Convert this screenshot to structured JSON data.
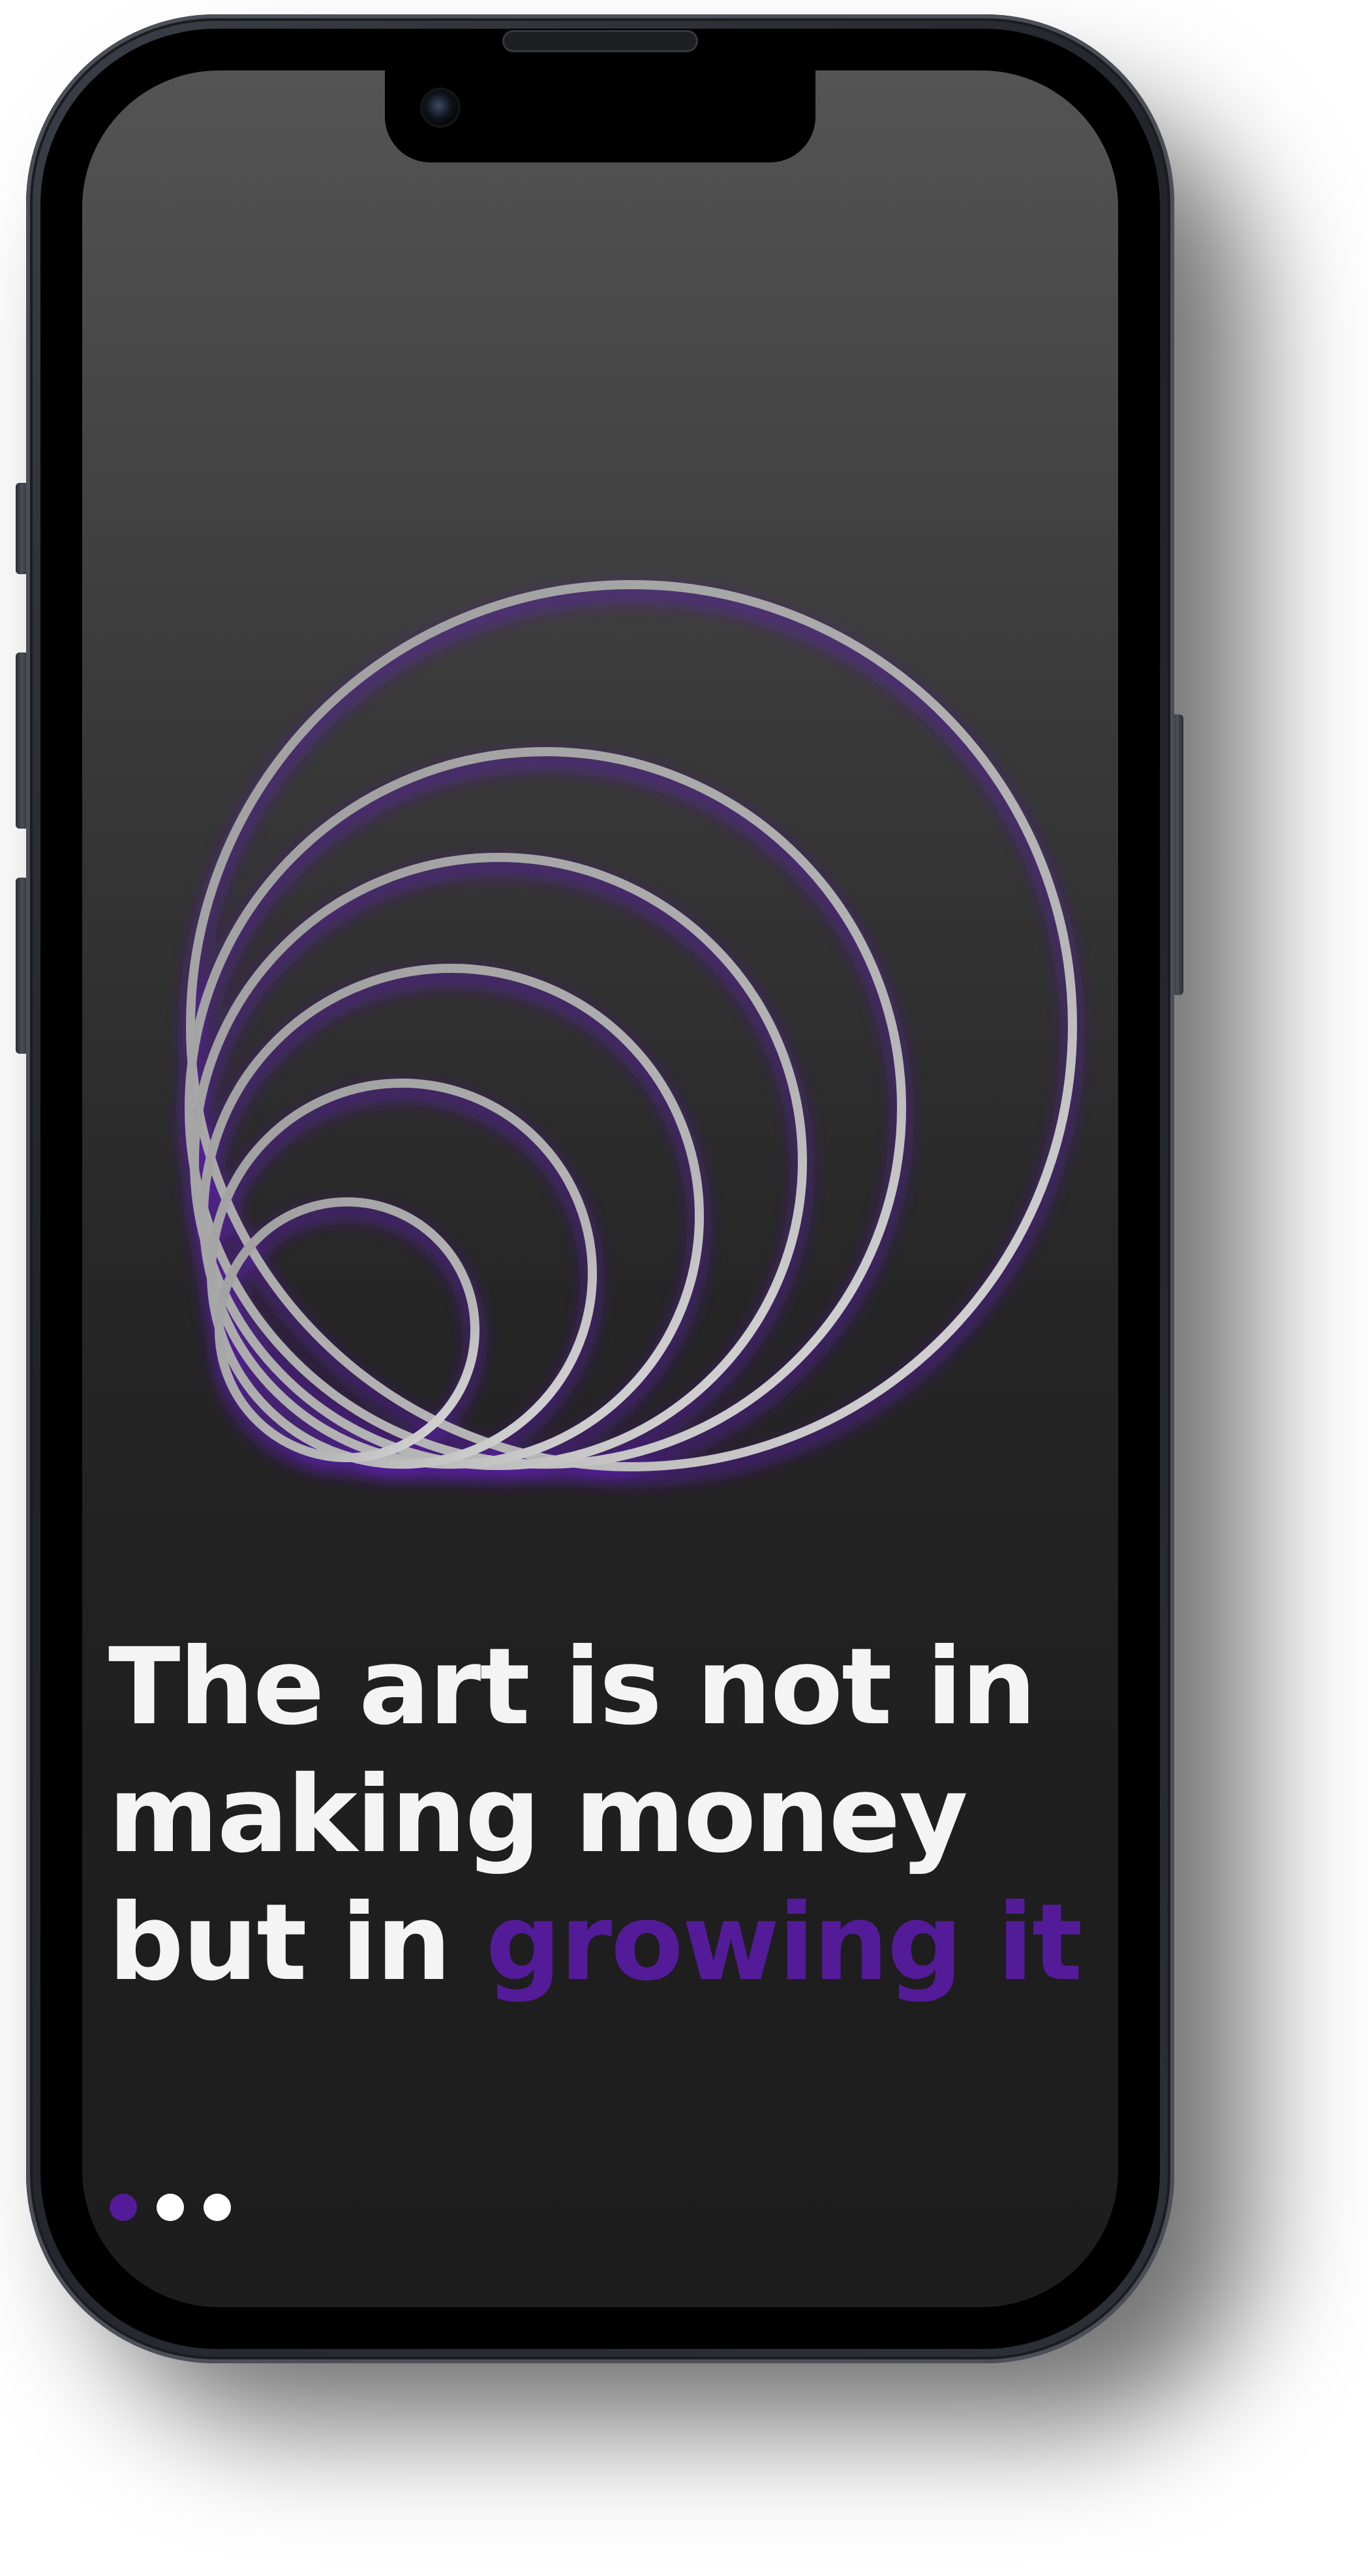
{
  "onboarding": {
    "headline_part1": "The art is not in making money but in",
    "headline_highlight": "growing it"
  },
  "pager": {
    "total": 3,
    "active_index": 0
  },
  "colors": {
    "accent": "#541b99",
    "headline": "#f4f4f4",
    "ring": "#b5b5b5",
    "screen_top": "#545454",
    "screen_bottom": "#1d1d1d"
  },
  "illustration": {
    "name": "concentric-rings-icon"
  }
}
